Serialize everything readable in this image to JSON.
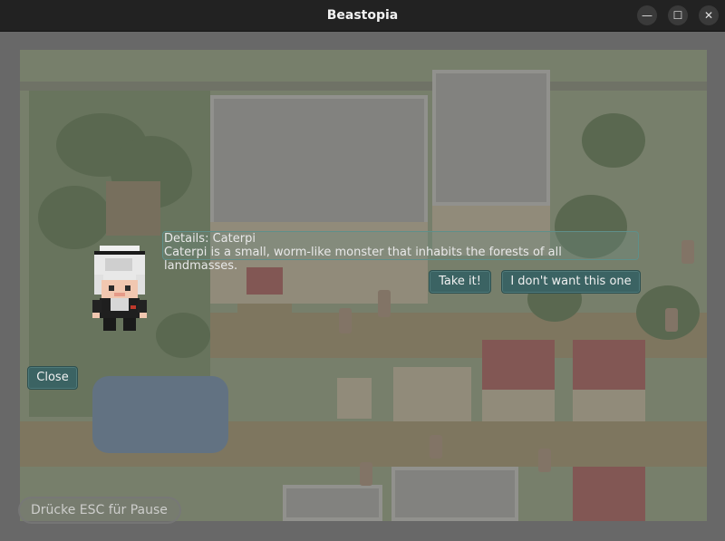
{
  "window": {
    "title": "Beastopia"
  },
  "dialog": {
    "details_title": "Details: Caterpi",
    "details_text": "Caterpi is a small, worm-like monster that inhabits the forests of all landmasses.",
    "take_label": "Take it!",
    "decline_label": "I don't want this one"
  },
  "close_label": "Close",
  "hint": "Drücke ESC für Pause",
  "colors": {
    "button_bg": "#3b6363",
    "title_bar": "#222222"
  },
  "icons": {
    "minimize": "minimize-icon",
    "maximize": "maximize-icon",
    "close": "close-icon"
  }
}
